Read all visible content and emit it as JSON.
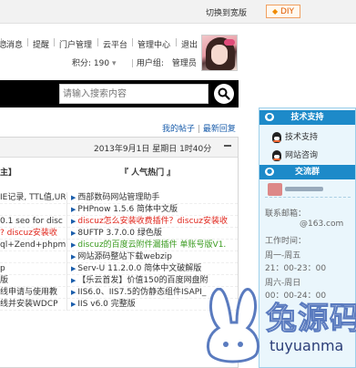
{
  "topbar": {
    "switch_wide": "切换到宽版",
    "diy_label": "DIY",
    "diy_icon": "diamond-icon"
  },
  "usernav": {
    "items": [
      "息",
      "消息",
      "提醒",
      "门户管理",
      "云平台",
      "管理中心",
      "退出"
    ],
    "sep": "|"
  },
  "credits": {
    "label": "积分: 190",
    "arrow": "▾",
    "group_label": "用户组:",
    "group_value": "管理员"
  },
  "search": {
    "placeholder": "请输入搜索内容"
  },
  "links": {
    "my_threads": "我的帖子",
    "latest_replies": "最新回复",
    "sep": "|"
  },
  "panel": {
    "date": "2013年9月1日 星期日 1时40分",
    "col_left_title": "主】",
    "col_right_title": "『 人气热门 』",
    "left_rows": [
      {
        "text": "IE记录, TTL值,UR",
        "color": "black"
      },
      {
        "text": "",
        "color": "black"
      },
      {
        "text": "0.1 seo for disc",
        "color": "black"
      },
      {
        "text": "? discuz安装收",
        "color": "red"
      },
      {
        "text": "ql+Zend+phpmy",
        "color": "black"
      },
      {
        "text": "",
        "color": "black"
      },
      {
        "text": "p",
        "color": "black"
      },
      {
        "text": "版",
        "color": "black"
      },
      {
        "text": "线申请与使用教",
        "color": "black"
      },
      {
        "text": "线并安装WDCP",
        "color": "black"
      }
    ],
    "right_rows": [
      {
        "text": "西部数码网站管理助手",
        "color": "black"
      },
      {
        "text": "PHPnow 1.5.6 简体中文版",
        "color": "black"
      },
      {
        "text": "discuz怎么安装收费插件？discuz安装收",
        "color": "red"
      },
      {
        "text": "8UFTP 3.7.0.0 绿色版",
        "color": "black"
      },
      {
        "text": "discuz的百度云附件漏插件 单账号版V1.",
        "color": "green"
      },
      {
        "text": "网站源码整站下载webzip",
        "color": "black"
      },
      {
        "text": "Serv-U 11.2.0.0 简体中文破解版",
        "color": "black"
      },
      {
        "text": "【乐云首发】价值150的百度网盘附",
        "color": "black"
      },
      {
        "text": "IIS6.0、IIS7.5的伪静态组件ISAPI_",
        "color": "black"
      },
      {
        "text": "IIS v6.0 完整版",
        "color": "black"
      }
    ]
  },
  "sidebar": {
    "tech_title": "技术支持",
    "tech_items": [
      "技术支持",
      "网站咨询"
    ],
    "group_title": "交流群",
    "email_label": "联系邮箱：",
    "email_value": "@163.com",
    "hours_label": "工作时间：",
    "weekday_label": "周一-周五",
    "weekday_hours": "21：00-23：00",
    "weekend_label": "周六-周日",
    "weekend_hours": "00：00-24：00"
  },
  "watermark": {
    "title": "兔源码",
    "sub": "tuyuanma"
  },
  "colors": {
    "accent": "#1d8ac9",
    "link": "#1a5dab",
    "red": "#e0251b",
    "green": "#3a9b1f"
  }
}
